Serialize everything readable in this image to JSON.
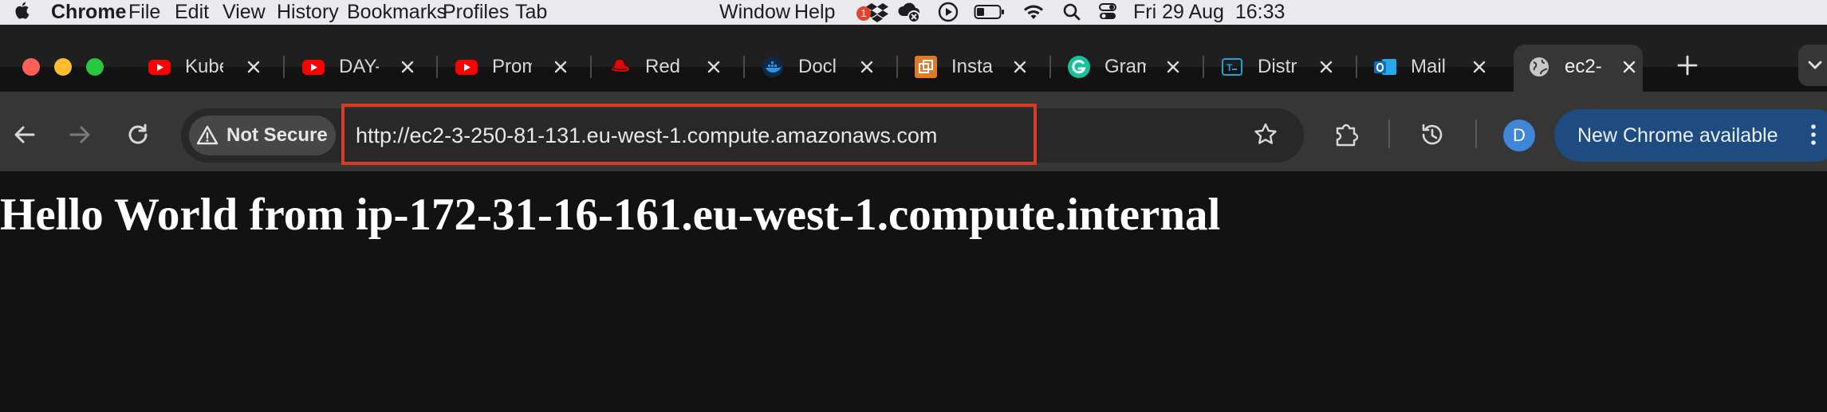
{
  "menubar": {
    "app_name": "Chrome",
    "items": [
      "File",
      "Edit",
      "View",
      "History",
      "Bookmarks",
      "Profiles",
      "Tab"
    ],
    "right_items": [
      "Window",
      "Help"
    ],
    "dropbox_badge": "1",
    "clock": "Fri 29 Aug  16:33"
  },
  "tabs": [
    {
      "title": "Kube",
      "favicon": "youtube-icon",
      "color": "#ff0000"
    },
    {
      "title": "DAY-",
      "favicon": "youtube-icon",
      "color": "#ff0000"
    },
    {
      "title": "Prom",
      "favicon": "youtube-icon",
      "color": "#ff0000"
    },
    {
      "title": "Red",
      "favicon": "redhat-icon",
      "color": "#ee0000"
    },
    {
      "title": "Docl",
      "favicon": "docker-icon",
      "color": "#2496ed"
    },
    {
      "title": "Insta",
      "favicon": "instance-icon",
      "color": "#e07b25"
    },
    {
      "title": "Gram",
      "favicon": "grammarly-icon",
      "color": "#15c39a"
    },
    {
      "title": "Distr",
      "favicon": "distr-icon",
      "color": "#2a9fd6"
    },
    {
      "title": "Mail",
      "favicon": "outlook-icon",
      "color": "#0f6cbd"
    },
    {
      "title": "ec2-",
      "favicon": "globe-icon",
      "color": "#c7c7c7",
      "active": true
    }
  ],
  "toolbar": {
    "security_label": "Not Secure",
    "url": "http://ec2-3-250-81-131.eu-west-1.compute.amazonaws.com",
    "profile_initial": "D",
    "update_label": "New Chrome available"
  },
  "page": {
    "heading": "Hello World from ip-172-31-16-161.eu-west-1.compute.internal"
  },
  "colors": {
    "highlight_box": "#d93a26",
    "update_pill": "#1e4b80",
    "page_bg": "#121212"
  }
}
